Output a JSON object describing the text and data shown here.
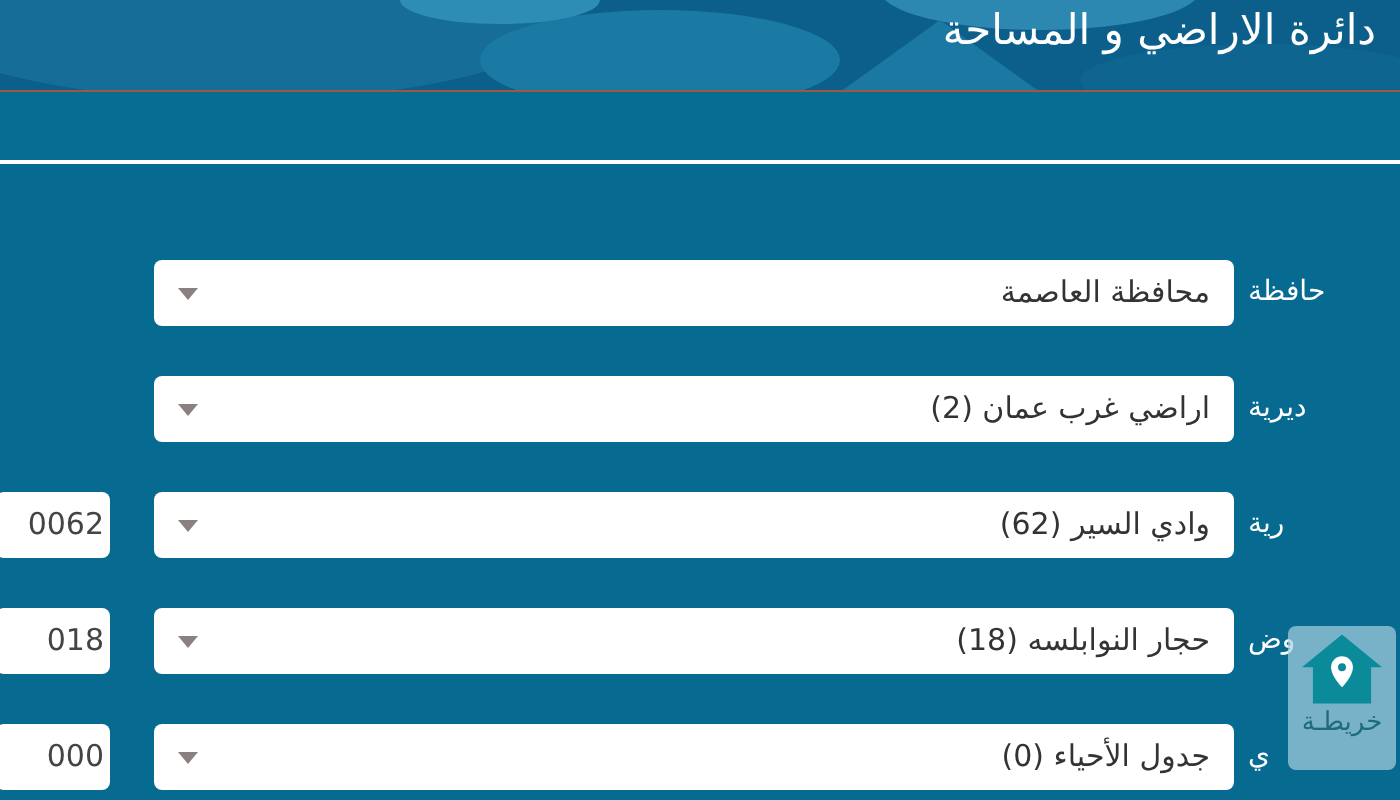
{
  "header": {
    "title": "دائرة الاراضي و المساحة"
  },
  "fields": [
    {
      "label": "حافظة",
      "value": "محافظة العاصمة"
    },
    {
      "label": "ديرية",
      "value": "اراضي غرب عمان (2)"
    },
    {
      "label": "رية",
      "value": "وادي السير (62)",
      "code": "0062"
    },
    {
      "label": "وض",
      "value": "حجار النوابلسه (18)",
      "code": "018"
    },
    {
      "label": "ي",
      "value": "جدول الأحياء (0)",
      "code": "000"
    }
  ],
  "map_button": {
    "label": "خريطـة"
  }
}
